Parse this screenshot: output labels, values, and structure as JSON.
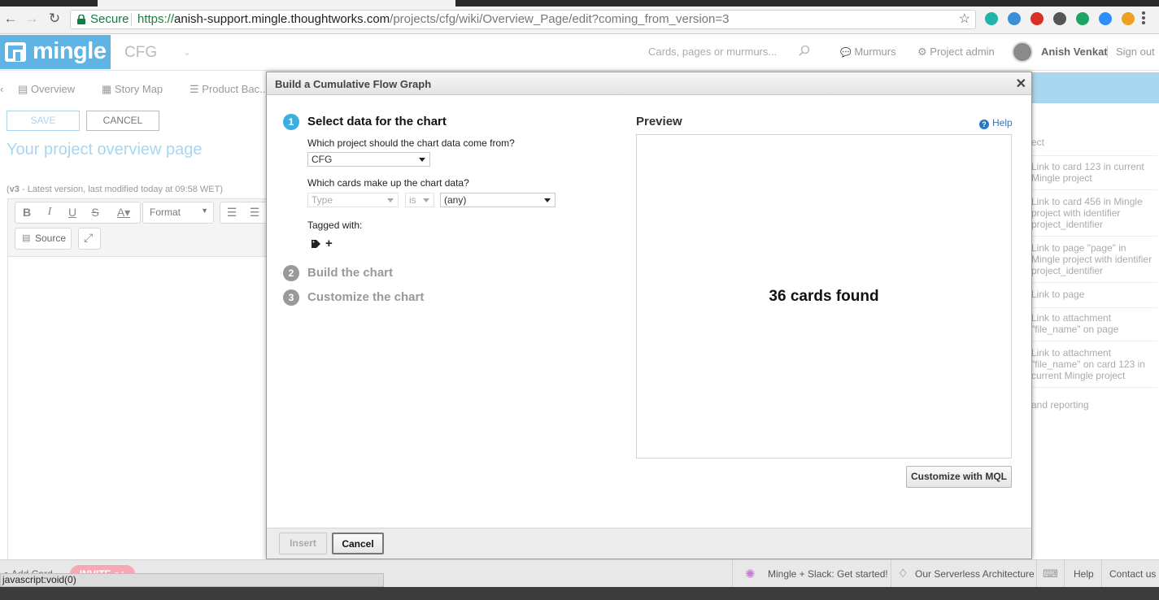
{
  "browser": {
    "secure_label": "Secure",
    "url_scheme": "https://",
    "url_host": "anish-support.mingle.thoughtworks.com",
    "url_path": "/projects/cfg/wiki/Overview_Page/edit?coming_from_version=3",
    "extension_colors": [
      "#1fb5a8",
      "#3b8fd8",
      "#d93025",
      "#555555",
      "#1ea362",
      "#2d8cff",
      "#f0a020"
    ]
  },
  "header": {
    "logo_text": "mingle",
    "project_name": "CFG",
    "search_placeholder": "Cards, pages or murmurs...",
    "murmurs": "Murmurs",
    "project_admin": "Project admin",
    "user_name": "Anish Venkat",
    "sign_out": "Sign out"
  },
  "page": {
    "tabs": [
      "Overview",
      "Story Map",
      "Product Bac..."
    ],
    "save": "SAVE",
    "cancel": "CANCEL",
    "title": "Your project overview page",
    "version_tag": "v3",
    "version_text": " - Latest version, last modified today at 09:58 WET)",
    "format_label": "Format",
    "source_label": "Source",
    "right_panel": [
      "ect",
      "Link to card 123 in current Mingle project",
      "Link to card 456 in Mingle project with identifier project_identifier",
      "Link to page \"page\" in Mingle project with identifier project_identifier",
      "Link to page",
      "Link to attachment \"file_name\" on page",
      "Link to attachment \"file_name\" on card 123 in current Mingle project",
      "and reporting"
    ]
  },
  "modal": {
    "title": "Build a Cumulative Flow Graph",
    "steps": [
      {
        "num": "1",
        "label": "Select data for the chart",
        "active": true
      },
      {
        "num": "2",
        "label": "Build the chart",
        "active": false
      },
      {
        "num": "3",
        "label": "Customize the chart",
        "active": false
      }
    ],
    "q_project": "Which project should the chart data come from?",
    "project_value": "CFG",
    "q_cards": "Which cards make up the chart data?",
    "filter_property": "Type",
    "filter_operator": "is",
    "filter_value": "(any)",
    "tagged_with": "Tagged with:",
    "preview_title": "Preview",
    "help": "Help",
    "preview_count": "36 cards found",
    "customize_mql": "Customize with MQL",
    "insert": "Insert",
    "cancel": "Cancel",
    "accent_color": "#3ab0e2"
  },
  "bottom": {
    "add_card": "Add Card",
    "invite": "INVITE",
    "slack": "Mingle + Slack: Get started!",
    "serverless": "Our Serverless Architecture",
    "help": "Help",
    "contact": "Contact us",
    "status_text": "javascript:void(0)"
  }
}
